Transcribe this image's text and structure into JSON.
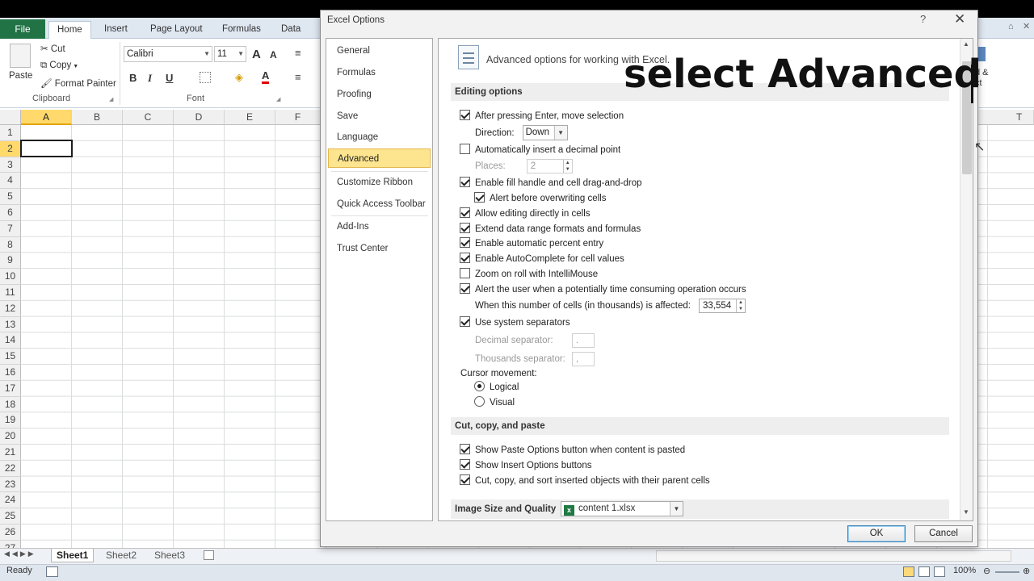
{
  "ribbon": {
    "file_tab": "File",
    "tabs": [
      "Home",
      "Insert",
      "Page Layout",
      "Formulas",
      "Data"
    ],
    "clipboard": {
      "paste": "Paste",
      "cut": "Cut",
      "copy": "Copy",
      "format_painter": "Format Painter",
      "group_label": "Clipboard"
    },
    "font": {
      "name": "Calibri",
      "size": "11",
      "group_label": "Font",
      "grow": "A",
      "shrink": "A",
      "bold": "B",
      "italic": "I",
      "underline": "U",
      "color_letter": "A"
    },
    "right_fragment": "d &\nct"
  },
  "grid": {
    "columns": [
      "A",
      "B",
      "C",
      "D",
      "E",
      "F"
    ],
    "right_column": "T",
    "rows": [
      "1",
      "2",
      "3",
      "4",
      "5",
      "6",
      "7",
      "8",
      "9",
      "10",
      "11",
      "12",
      "13",
      "14",
      "15",
      "16",
      "17",
      "18",
      "19",
      "20",
      "21",
      "22",
      "23",
      "24",
      "25",
      "26",
      "27"
    ]
  },
  "sheets": [
    "Sheet1",
    "Sheet2",
    "Sheet3"
  ],
  "status": {
    "ready": "Ready",
    "zoom": "100%"
  },
  "dialog": {
    "title": "Excel Options",
    "help": "?",
    "close": "✕",
    "nav": [
      "General",
      "Formulas",
      "Proofing",
      "Save",
      "Language",
      "Advanced",
      "Customize Ribbon",
      "Quick Access Toolbar",
      "Add-Ins",
      "Trust Center"
    ],
    "header": "Advanced options for working with Excel.",
    "sections": {
      "editing": "Editing options",
      "cutcopy": "Cut, copy, and paste",
      "image": "Image Size and Quality"
    },
    "options": {
      "after_enter": "After pressing Enter, move selection",
      "direction_label": "Direction:",
      "direction_value": "Down",
      "auto_decimal": "Automatically insert a decimal point",
      "places_label": "Places:",
      "places_value": "2",
      "fill_handle": "Enable fill handle and cell drag-and-drop",
      "alert_overwrite": "Alert before overwriting cells",
      "allow_editing": "Allow editing directly in cells",
      "extend_formats": "Extend data range formats and formulas",
      "percent_entry": "Enable automatic percent entry",
      "autocomplete": "Enable AutoComplete for cell values",
      "zoom_roll": "Zoom on roll with IntelliMouse",
      "alert_time": "Alert the user when a potentially time consuming operation occurs",
      "cells_affected_label": "When this number of cells (in thousands) is affected:",
      "cells_affected_value": "33,554",
      "system_separators": "Use system separators",
      "decimal_sep_label": "Decimal separator:",
      "decimal_sep_value": ".",
      "thousands_sep_label": "Thousands separator:",
      "thousands_sep_value": ",",
      "cursor_movement": "Cursor movement:",
      "logical": "Logical",
      "visual": "Visual",
      "show_paste": "Show Paste Options button when content is pasted",
      "show_insert": "Show Insert Options buttons",
      "cut_copy_sort": "Cut, copy, and sort inserted objects with their parent cells",
      "image_file": "content 1.xlsx"
    },
    "ok": "OK",
    "cancel": "Cancel"
  },
  "overlay_text": "select Advanced"
}
